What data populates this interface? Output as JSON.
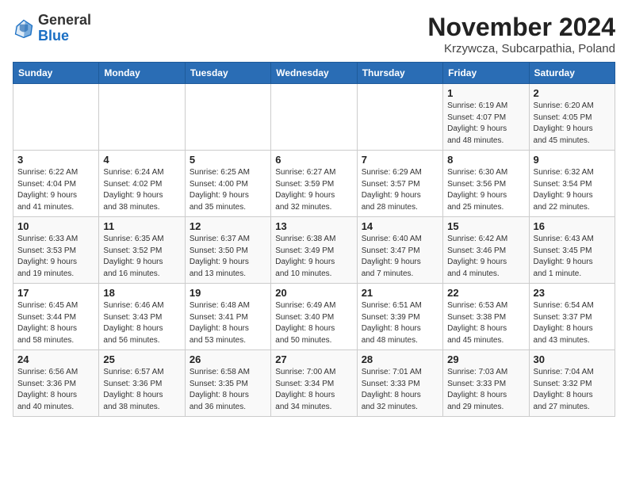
{
  "header": {
    "logo_line1": "General",
    "logo_line2": "Blue",
    "month": "November 2024",
    "location": "Krzywcza, Subcarpathia, Poland"
  },
  "weekdays": [
    "Sunday",
    "Monday",
    "Tuesday",
    "Wednesday",
    "Thursday",
    "Friday",
    "Saturday"
  ],
  "weeks": [
    [
      {
        "day": "",
        "info": ""
      },
      {
        "day": "",
        "info": ""
      },
      {
        "day": "",
        "info": ""
      },
      {
        "day": "",
        "info": ""
      },
      {
        "day": "",
        "info": ""
      },
      {
        "day": "1",
        "info": "Sunrise: 6:19 AM\nSunset: 4:07 PM\nDaylight: 9 hours\nand 48 minutes."
      },
      {
        "day": "2",
        "info": "Sunrise: 6:20 AM\nSunset: 4:05 PM\nDaylight: 9 hours\nand 45 minutes."
      }
    ],
    [
      {
        "day": "3",
        "info": "Sunrise: 6:22 AM\nSunset: 4:04 PM\nDaylight: 9 hours\nand 41 minutes."
      },
      {
        "day": "4",
        "info": "Sunrise: 6:24 AM\nSunset: 4:02 PM\nDaylight: 9 hours\nand 38 minutes."
      },
      {
        "day": "5",
        "info": "Sunrise: 6:25 AM\nSunset: 4:00 PM\nDaylight: 9 hours\nand 35 minutes."
      },
      {
        "day": "6",
        "info": "Sunrise: 6:27 AM\nSunset: 3:59 PM\nDaylight: 9 hours\nand 32 minutes."
      },
      {
        "day": "7",
        "info": "Sunrise: 6:29 AM\nSunset: 3:57 PM\nDaylight: 9 hours\nand 28 minutes."
      },
      {
        "day": "8",
        "info": "Sunrise: 6:30 AM\nSunset: 3:56 PM\nDaylight: 9 hours\nand 25 minutes."
      },
      {
        "day": "9",
        "info": "Sunrise: 6:32 AM\nSunset: 3:54 PM\nDaylight: 9 hours\nand 22 minutes."
      }
    ],
    [
      {
        "day": "10",
        "info": "Sunrise: 6:33 AM\nSunset: 3:53 PM\nDaylight: 9 hours\nand 19 minutes."
      },
      {
        "day": "11",
        "info": "Sunrise: 6:35 AM\nSunset: 3:52 PM\nDaylight: 9 hours\nand 16 minutes."
      },
      {
        "day": "12",
        "info": "Sunrise: 6:37 AM\nSunset: 3:50 PM\nDaylight: 9 hours\nand 13 minutes."
      },
      {
        "day": "13",
        "info": "Sunrise: 6:38 AM\nSunset: 3:49 PM\nDaylight: 9 hours\nand 10 minutes."
      },
      {
        "day": "14",
        "info": "Sunrise: 6:40 AM\nSunset: 3:47 PM\nDaylight: 9 hours\nand 7 minutes."
      },
      {
        "day": "15",
        "info": "Sunrise: 6:42 AM\nSunset: 3:46 PM\nDaylight: 9 hours\nand 4 minutes."
      },
      {
        "day": "16",
        "info": "Sunrise: 6:43 AM\nSunset: 3:45 PM\nDaylight: 9 hours\nand 1 minute."
      }
    ],
    [
      {
        "day": "17",
        "info": "Sunrise: 6:45 AM\nSunset: 3:44 PM\nDaylight: 8 hours\nand 58 minutes."
      },
      {
        "day": "18",
        "info": "Sunrise: 6:46 AM\nSunset: 3:43 PM\nDaylight: 8 hours\nand 56 minutes."
      },
      {
        "day": "19",
        "info": "Sunrise: 6:48 AM\nSunset: 3:41 PM\nDaylight: 8 hours\nand 53 minutes."
      },
      {
        "day": "20",
        "info": "Sunrise: 6:49 AM\nSunset: 3:40 PM\nDaylight: 8 hours\nand 50 minutes."
      },
      {
        "day": "21",
        "info": "Sunrise: 6:51 AM\nSunset: 3:39 PM\nDaylight: 8 hours\nand 48 minutes."
      },
      {
        "day": "22",
        "info": "Sunrise: 6:53 AM\nSunset: 3:38 PM\nDaylight: 8 hours\nand 45 minutes."
      },
      {
        "day": "23",
        "info": "Sunrise: 6:54 AM\nSunset: 3:37 PM\nDaylight: 8 hours\nand 43 minutes."
      }
    ],
    [
      {
        "day": "24",
        "info": "Sunrise: 6:56 AM\nSunset: 3:36 PM\nDaylight: 8 hours\nand 40 minutes."
      },
      {
        "day": "25",
        "info": "Sunrise: 6:57 AM\nSunset: 3:36 PM\nDaylight: 8 hours\nand 38 minutes."
      },
      {
        "day": "26",
        "info": "Sunrise: 6:58 AM\nSunset: 3:35 PM\nDaylight: 8 hours\nand 36 minutes."
      },
      {
        "day": "27",
        "info": "Sunrise: 7:00 AM\nSunset: 3:34 PM\nDaylight: 8 hours\nand 34 minutes."
      },
      {
        "day": "28",
        "info": "Sunrise: 7:01 AM\nSunset: 3:33 PM\nDaylight: 8 hours\nand 32 minutes."
      },
      {
        "day": "29",
        "info": "Sunrise: 7:03 AM\nSunset: 3:33 PM\nDaylight: 8 hours\nand 29 minutes."
      },
      {
        "day": "30",
        "info": "Sunrise: 7:04 AM\nSunset: 3:32 PM\nDaylight: 8 hours\nand 27 minutes."
      }
    ]
  ]
}
